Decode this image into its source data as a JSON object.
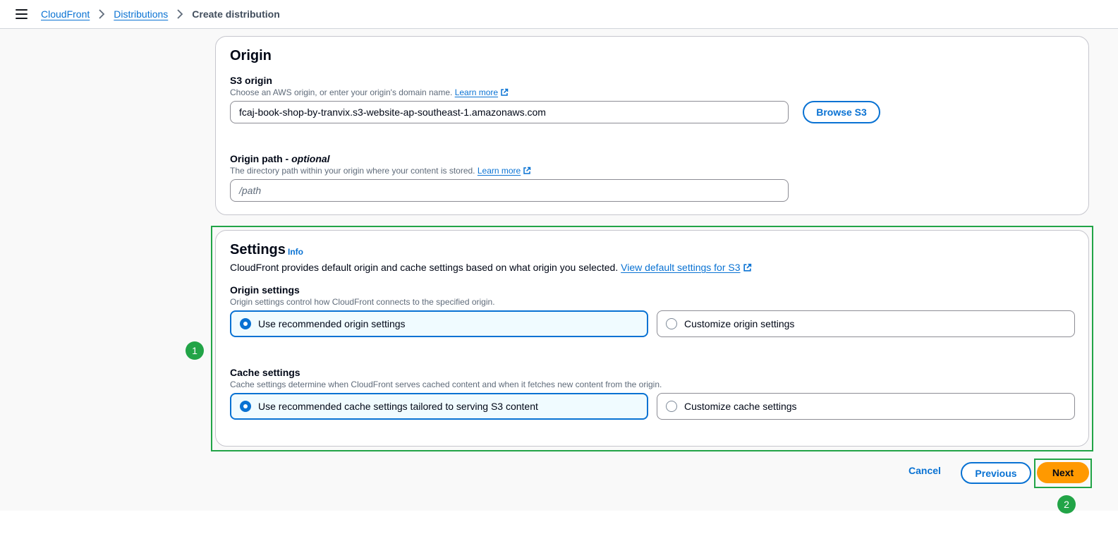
{
  "breadcrumb": {
    "items": [
      "CloudFront",
      "Distributions"
    ],
    "current": "Create distribution"
  },
  "origin": {
    "title": "Origin",
    "s3_label": "S3 origin",
    "s3_desc": "Choose an AWS origin, or enter your origin's domain name.",
    "learn_more": "Learn more",
    "s3_value": "fcaj-book-shop-by-tranvix.s3-website-ap-southeast-1.amazonaws.com",
    "browse_label": "Browse S3",
    "path_label": "Origin path - ",
    "path_optional": "optional",
    "path_desc": "The directory path within your origin where your content is stored.",
    "path_placeholder": "/path"
  },
  "settings": {
    "title": "Settings",
    "info": "Info",
    "desc": "CloudFront provides default origin and cache settings based on what origin you selected.",
    "view_defaults": "View default settings for S3",
    "origin_settings_label": "Origin settings",
    "origin_settings_desc": "Origin settings control how CloudFront connects to the specified origin.",
    "origin_options": [
      "Use recommended origin settings",
      "Customize origin settings"
    ],
    "origin_selected": 0,
    "cache_settings_label": "Cache settings",
    "cache_settings_desc": "Cache settings determine when CloudFront serves cached content and when it fetches new content from the origin.",
    "cache_options": [
      "Use recommended cache settings tailored to serving S3 content",
      "Customize cache settings"
    ],
    "cache_selected": 0
  },
  "footer": {
    "cancel": "Cancel",
    "previous": "Previous",
    "next": "Next"
  },
  "annotations": {
    "badge_1": "1",
    "badge_2": "2",
    "highlight_color": "#22a447"
  },
  "colors": {
    "accent": "#0972d3",
    "primary_button": "#ff9900"
  }
}
